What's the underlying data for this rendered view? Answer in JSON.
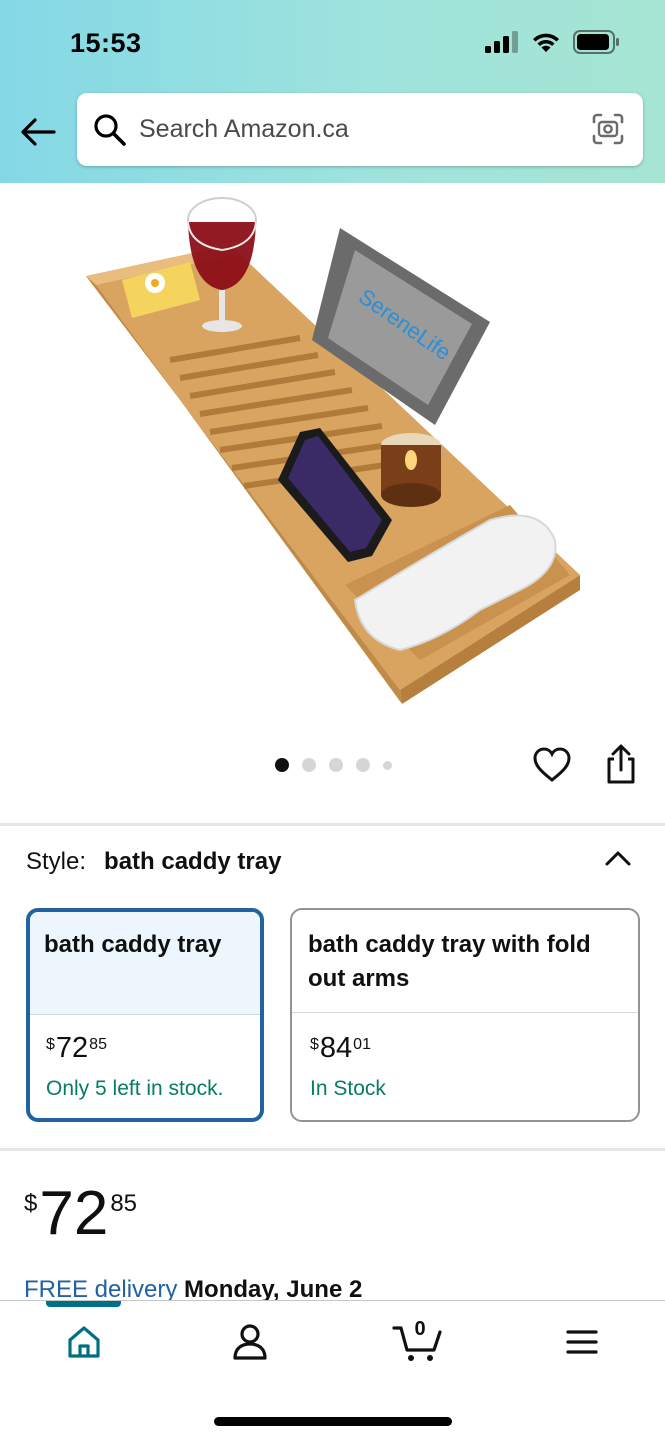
{
  "status_bar": {
    "time": "15:53"
  },
  "search": {
    "placeholder": "Search Amazon.ca"
  },
  "product_image": {
    "description_icon": "bath-caddy-tray-product-photo",
    "brand_text": "SereneLife",
    "dots_total": 5,
    "dots_active_index": 0
  },
  "style": {
    "label": "Style:",
    "selected": "bath caddy tray",
    "options": [
      {
        "name": "bath caddy tray",
        "price_symbol": "$",
        "price_whole": "72",
        "price_cents": "85",
        "stock": "Only 5 left in stock.",
        "selected": true
      },
      {
        "name": "bath caddy tray with fold out arms",
        "price_symbol": "$",
        "price_whole": "84",
        "price_cents": "01",
        "stock": "In Stock",
        "selected": false
      }
    ]
  },
  "price": {
    "symbol": "$",
    "whole": "72",
    "cents": "85"
  },
  "delivery": {
    "link": "FREE delivery",
    "date": "Monday, June 2"
  },
  "bottom_nav": {
    "items": [
      "home-icon",
      "account-icon",
      "cart-icon",
      "menu-icon"
    ],
    "cart_count": "0"
  },
  "colors": {
    "accent_blue": "#2162a1",
    "stock_green": "#067d62",
    "nav_teal": "#007185"
  }
}
